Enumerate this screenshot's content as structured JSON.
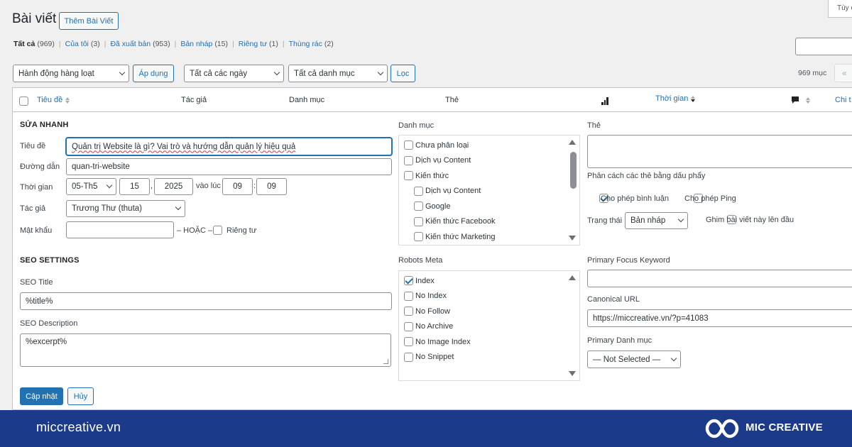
{
  "header": {
    "title": "Bài viết",
    "add_new": "Thêm Bài Viết",
    "screen_options": "Tùy c"
  },
  "filters": [
    {
      "label": "Tất cả",
      "count": "(969)",
      "current": true
    },
    {
      "label": "Của tôi",
      "count": "(3)"
    },
    {
      "label": "Đã xuất bản",
      "count": "(953)"
    },
    {
      "label": "Bản nháp",
      "count": "(15)"
    },
    {
      "label": "Riêng tư",
      "count": "(1)"
    },
    {
      "label": "Thùng rác",
      "count": "(2)"
    }
  ],
  "toolbar": {
    "bulk_action": "Hành động hàng loạt",
    "apply": "Áp dụng",
    "dates": "Tất cả các ngày",
    "categories": "Tất cả danh mục",
    "filter": "Lọc",
    "items_count": "969 mục",
    "first_page": "«"
  },
  "table": {
    "col_title": "Tiêu đề",
    "col_author": "Tác giả",
    "col_category": "Danh mục",
    "col_tags": "Thẻ",
    "col_date": "Thời gian",
    "col_detail": "Chi t",
    "sort_icon": "sort-icon",
    "stats_icon": "chart-bar-icon",
    "comment_icon": "comment-icon"
  },
  "quick_edit": {
    "heading": "SỬA NHANH",
    "title_label": "Tiêu đề",
    "title_value": "Quản trị Website là gì? Vai trò và hướng dẫn quản lý hiệu quả",
    "slug_label": "Đường dẫn",
    "slug_value": "quan-tri-website",
    "date_label": "Thời gian",
    "month": "05-Th5",
    "day": "15",
    "year": "2025",
    "at_label": "vào lúc",
    "hour": "09",
    "minute": "09",
    "date_sep": ",",
    "time_sep": ":",
    "author_label": "Tác giả",
    "author_value": "Trương Thư (thuta)",
    "password_label": "Mật khẩu",
    "password_value": "",
    "or_label": "– HOẶC –",
    "private_label": "Riêng tư",
    "category_label": "Danh mục",
    "categories": [
      {
        "label": "Chưa phân loại",
        "checked": false,
        "indent": 0
      },
      {
        "label": "Dịch vụ Content",
        "checked": false,
        "indent": 0
      },
      {
        "label": "Kiến thức",
        "checked": false,
        "indent": 0
      },
      {
        "label": "Dịch vụ Content",
        "checked": false,
        "indent": 1
      },
      {
        "label": "Google",
        "checked": false,
        "indent": 1
      },
      {
        "label": "Kiến thức Facebook",
        "checked": false,
        "indent": 1
      },
      {
        "label": "Kiến thức Marketing",
        "checked": false,
        "indent": 1
      }
    ],
    "tags_label": "Thẻ",
    "tags_value": "",
    "tags_hint": "Phân cách các thẻ bằng dấu phẩy",
    "allow_comments": "Cho phép bình luận",
    "allow_comments_checked": true,
    "allow_pings": "Cho phép Ping",
    "allow_pings_checked": false,
    "status_label": "Trạng thái",
    "status_value": "Bản nháp",
    "sticky_label": "Ghim bài viết này lên đầu"
  },
  "seo": {
    "heading": "SEO SETTINGS",
    "title_label": "SEO Title",
    "title_value": "%title%",
    "desc_label": "SEO Description",
    "desc_value": "%excerpt%",
    "robots_label": "Robots Meta",
    "robots": [
      {
        "label": "Index",
        "checked": true
      },
      {
        "label": "No Index",
        "checked": false
      },
      {
        "label": "No Follow",
        "checked": false
      },
      {
        "label": "No Archive",
        "checked": false
      },
      {
        "label": "No Image Index",
        "checked": false
      },
      {
        "label": "No Snippet",
        "checked": false
      }
    ],
    "focus_label": "Primary Focus Keyword",
    "focus_value": "",
    "canonical_label": "Canonical URL",
    "canonical_value": "https://miccreative.vn/?p=41083",
    "primary_cat_label": "Primary Danh mục",
    "primary_cat_value": "— Not Selected —"
  },
  "actions": {
    "update": "Cập nhật",
    "cancel": "Hủy"
  },
  "footer": {
    "site": "miccreative.vn",
    "brand": "MIC CREATIVE",
    "bg": "#1b3a8a"
  },
  "colors": {
    "accent": "#2271b1",
    "primary_button": "#2271b1"
  }
}
